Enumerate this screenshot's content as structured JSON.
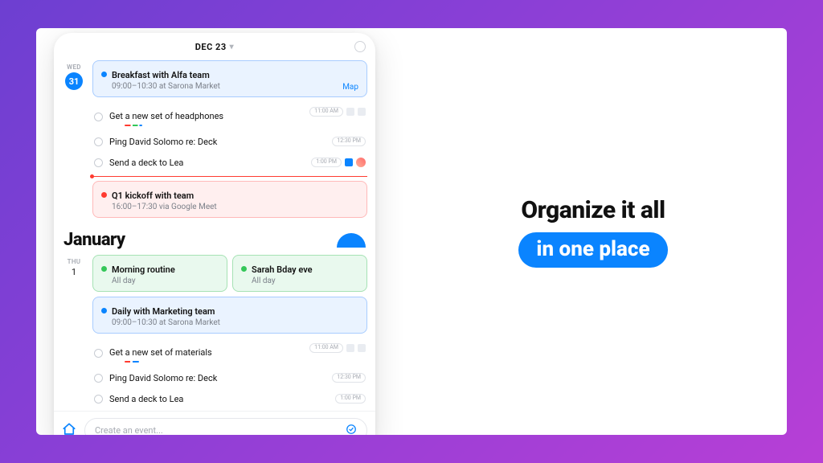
{
  "header": {
    "date_label": "DEC 23"
  },
  "dec": {
    "day_label": "WED",
    "day_number": "31",
    "events": [
      {
        "title": "Breakfast with Alfa team",
        "sub": "09:00–10:30 at Sarona Market",
        "color": "blue",
        "map_label": "Map"
      }
    ],
    "tasks": [
      {
        "title": "Get a new set of headphones",
        "pill": "11:00 AM",
        "repeat": true,
        "accent": true
      },
      {
        "title": "Ping David Solomo re: Deck",
        "pill": "12:30 PM"
      },
      {
        "title": "Send a deck to Lea",
        "pill": "1:00 PM",
        "flag": true,
        "avatar": true
      }
    ],
    "now_event": {
      "title": "Q1 kickoff with team",
      "sub": "16:00–17:30 via Google Meet",
      "color": "red"
    }
  },
  "month": {
    "title": "January"
  },
  "jan": {
    "day_label": "THU",
    "day_number": "1",
    "pair": [
      {
        "title": "Morning routine",
        "sub": "All day",
        "color": "green"
      },
      {
        "title": "Sarah Bday eve",
        "sub": "All day",
        "color": "green"
      }
    ],
    "event": {
      "title": "Daily with Marketing team",
      "sub": "09:00–10:30 at Sarona Market",
      "color": "blue"
    },
    "tasks": [
      {
        "title": "Get a new set of materials",
        "pill": "11:00 AM",
        "repeat": true,
        "accent_thin": true
      },
      {
        "title": "Ping David Solomo re: Deck",
        "pill": "12:30 PM"
      },
      {
        "title": "Send a deck to Lea",
        "pill": "1:00 PM"
      }
    ]
  },
  "input": {
    "placeholder": "Create an event..."
  },
  "promo": {
    "line1": "Organize it all",
    "line2": "in one place"
  }
}
